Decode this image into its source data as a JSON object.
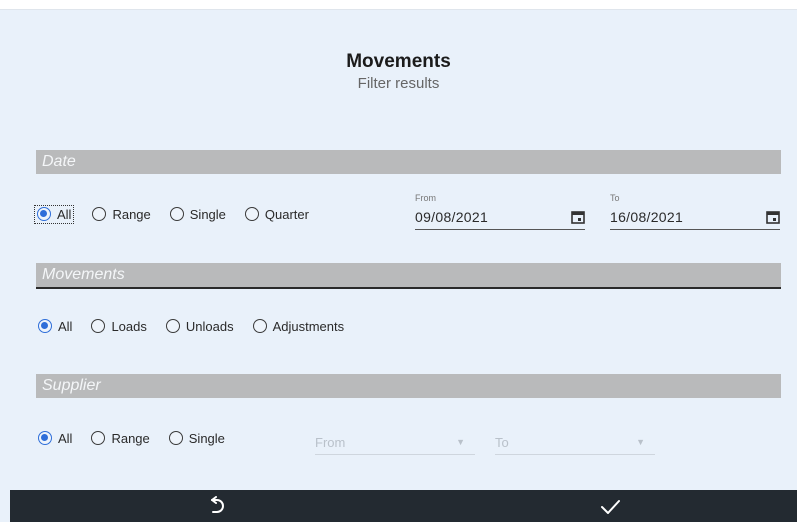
{
  "header": {
    "title": "Movements",
    "subtitle": "Filter results"
  },
  "date": {
    "section_label": "Date",
    "options": [
      "All",
      "Range",
      "Single",
      "Quarter"
    ],
    "selected": "All",
    "from": {
      "label": "From",
      "value": "09/08/2021"
    },
    "to": {
      "label": "To",
      "value": "16/08/2021"
    }
  },
  "movements": {
    "section_label": "Movements",
    "options": [
      "All",
      "Loads",
      "Unloads",
      "Adjustments"
    ],
    "selected": "All"
  },
  "supplier": {
    "section_label": "Supplier",
    "options": [
      "All",
      "Range",
      "Single"
    ],
    "selected": "All",
    "from_placeholder": "From",
    "to_placeholder": "To"
  },
  "footer": {
    "reset_icon": "undo-icon",
    "apply_icon": "check-icon"
  },
  "colors": {
    "accent": "#2e6ed9",
    "section_bar": "#b9babb",
    "footer": "#232a31",
    "background": "#e9f1fa"
  }
}
